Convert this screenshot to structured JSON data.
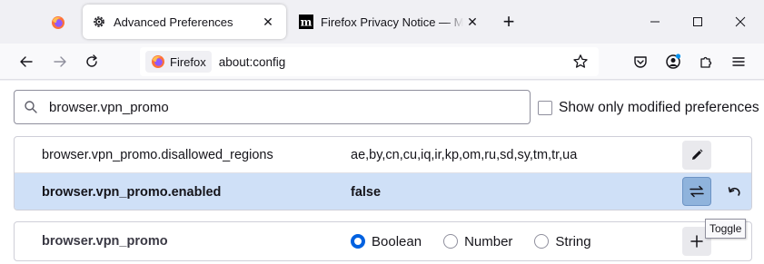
{
  "tabs": {
    "pinned_icon": "firefox-logo",
    "active": {
      "title": "Advanced Preferences",
      "icon": "gear-icon"
    },
    "inactive": {
      "title": "Firefox Privacy Notice — Mozilla",
      "icon": "mozilla-m-logo"
    }
  },
  "window_controls": {
    "minimize": "–",
    "maximize": "□",
    "close": "✕"
  },
  "nav": {
    "identity_label": "Firefox",
    "url": "about:config"
  },
  "search": {
    "value": "browser.vpn_promo"
  },
  "modified_checkbox_label": "Show only modified preferences",
  "preferences": [
    {
      "name": "browser.vpn_promo.disallowed_regions",
      "value": "ae,by,cn,cu,iq,ir,kp,om,ru,sd,sy,tm,tr,ua"
    },
    {
      "name": "browser.vpn_promo.enabled",
      "value": "false"
    }
  ],
  "new_pref": {
    "name": "browser.vpn_promo",
    "types": [
      "Boolean",
      "Number",
      "String"
    ],
    "selected": "Boolean"
  },
  "tooltip": "Toggle",
  "colors": {
    "accent": "#0061e0",
    "selected_row": "#cfe0f7",
    "toggle_button": "#8fb3dc"
  }
}
